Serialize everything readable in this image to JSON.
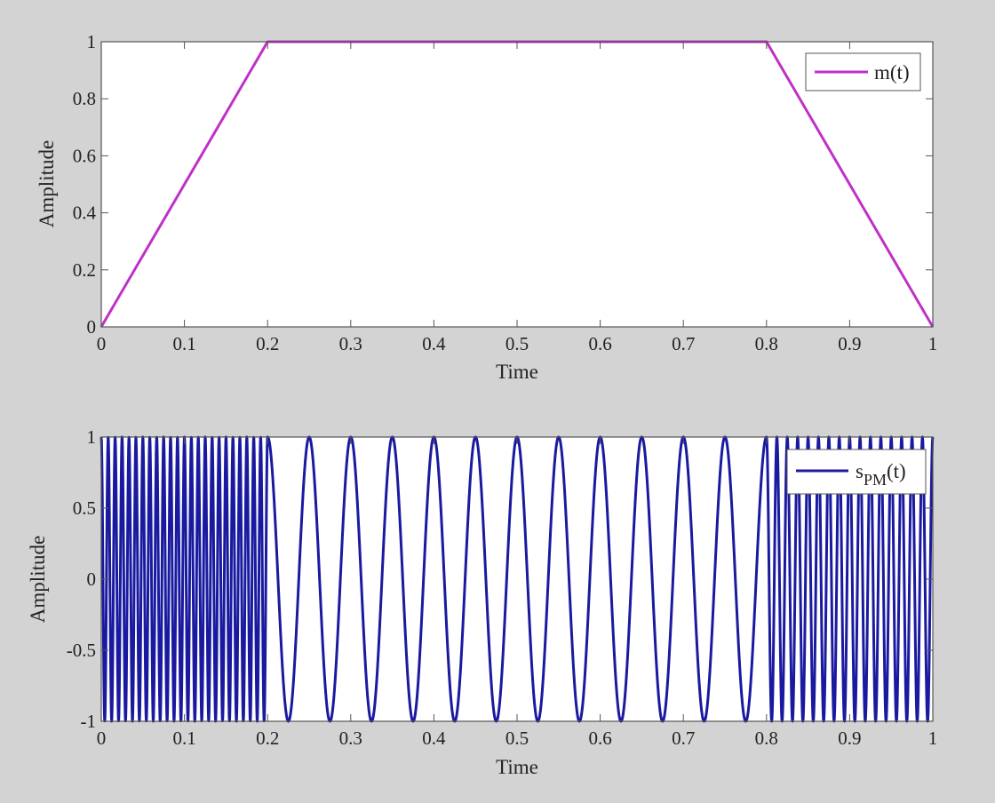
{
  "colors": {
    "figure_background": "#d3d3d3",
    "axes_background": "#ffffff",
    "axis_frame": "#555555"
  },
  "chart_data": [
    {
      "type": "line",
      "xlabel": "Time",
      "ylabel": "Amplitude",
      "xlim": [
        0,
        1
      ],
      "ylim": [
        0,
        1
      ],
      "grid": false,
      "legend_position": "top-right",
      "xticks": [
        "0",
        "0.1",
        "0.2",
        "0.3",
        "0.4",
        "0.5",
        "0.6",
        "0.7",
        "0.8",
        "0.9",
        "1"
      ],
      "yticks": [
        "0",
        "0.2",
        "0.4",
        "0.6",
        "0.8",
        "1"
      ],
      "series": [
        {
          "name": "m(t)",
          "color": "#c030c8",
          "x": [
            0,
            0.2,
            0.8,
            1
          ],
          "y": [
            0,
            1,
            1,
            0
          ]
        }
      ]
    },
    {
      "type": "line",
      "xlabel": "Time",
      "ylabel": "Amplitude",
      "xlim": [
        0,
        1
      ],
      "ylim": [
        -1,
        1
      ],
      "grid": false,
      "legend_position": "top-right",
      "xticks": [
        "0",
        "0.1",
        "0.2",
        "0.3",
        "0.4",
        "0.5",
        "0.6",
        "0.7",
        "0.8",
        "0.9",
        "1"
      ],
      "yticks": [
        "-1",
        "-0.5",
        "0",
        "0.5",
        "1"
      ],
      "series": [
        {
          "name": "sPM(t)",
          "name_base": "s",
          "name_subscript": "PM",
          "name_suffix": "(t)",
          "color": "#1a1aa0",
          "function": "cos(2*pi*fc*t + kp*m(t))",
          "fc": 20,
          "kp_rad": 125.66,
          "x_range": [
            0,
            1
          ]
        }
      ]
    }
  ]
}
